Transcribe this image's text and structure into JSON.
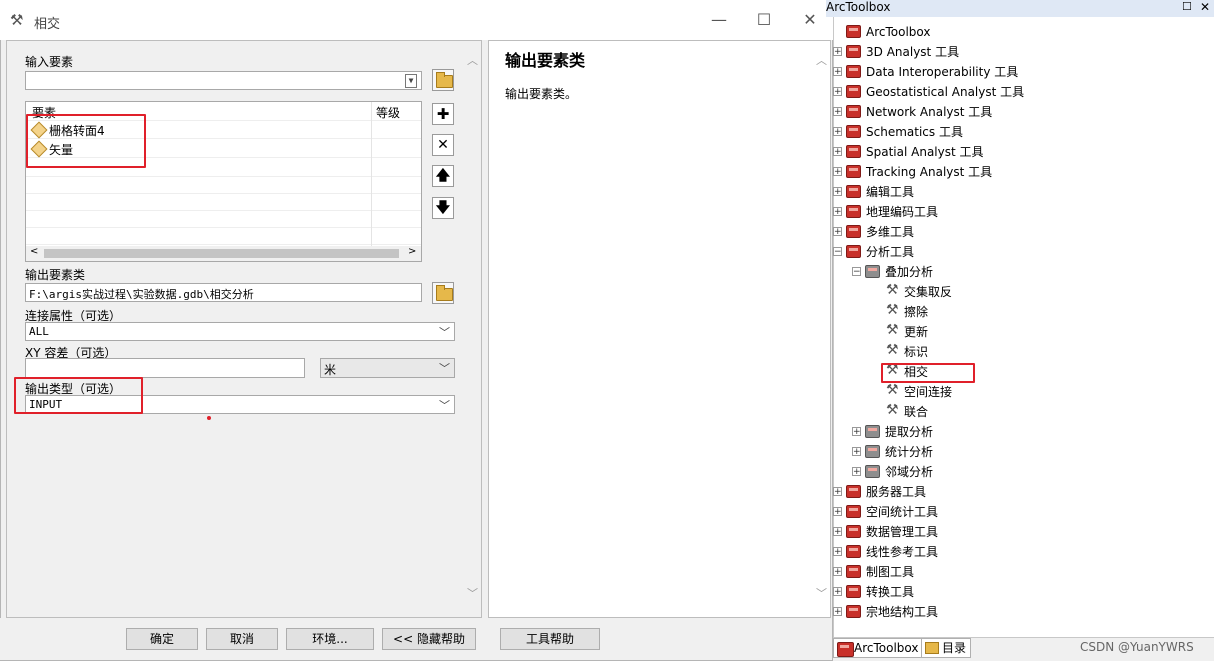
{
  "dialog": {
    "title": "相交",
    "input_features_label": "输入要素",
    "table_header_feature": "要素",
    "table_header_rank": "等级",
    "features": [
      "栅格转面4",
      "矢量"
    ],
    "output_label": "输出要素类",
    "output_value": "F:\\argis实战过程\\实验数据.gdb\\相交分析",
    "join_attr_label": "连接属性（可选）",
    "join_attr_value": "ALL",
    "xy_tol_label": "XY 容差（可选）",
    "xy_tol_value": "",
    "xy_tol_unit": "米",
    "output_type_label": "输出类型（可选）",
    "output_type_value": "INPUT",
    "help_title": "输出要素类",
    "help_text": "输出要素类。",
    "buttons": {
      "ok": "确定",
      "cancel": "取消",
      "env": "环境...",
      "hide_help": "<< 隐藏帮助",
      "tool_help": "工具帮助"
    }
  },
  "toolbox": {
    "header": "ArcToolbox",
    "root": "ArcToolbox",
    "items": [
      "3D Analyst 工具",
      "Data Interoperability 工具",
      "Geostatistical Analyst 工具",
      "Network Analyst 工具",
      "Schematics 工具",
      "Spatial Analyst 工具",
      "Tracking Analyst 工具",
      "编辑工具",
      "地理编码工具",
      "多维工具",
      "分析工具"
    ],
    "overlay_group": "叠加分析",
    "overlay_tools": [
      "交集取反",
      "擦除",
      "更新",
      "标识",
      "相交",
      "空间连接",
      "联合"
    ],
    "sub_groups": [
      "提取分析",
      "统计分析",
      "邻域分析"
    ],
    "more_items": [
      "服务器工具",
      "空间统计工具",
      "数据管理工具",
      "线性参考工具",
      "制图工具",
      "转换工具",
      "宗地结构工具"
    ],
    "tabs": [
      "ArcToolbox",
      "目录"
    ],
    "watermark": "CSDN @YuanYWRS"
  },
  "colors": {
    "highlight": "#e0202a",
    "tool_red": "#c8302a"
  }
}
